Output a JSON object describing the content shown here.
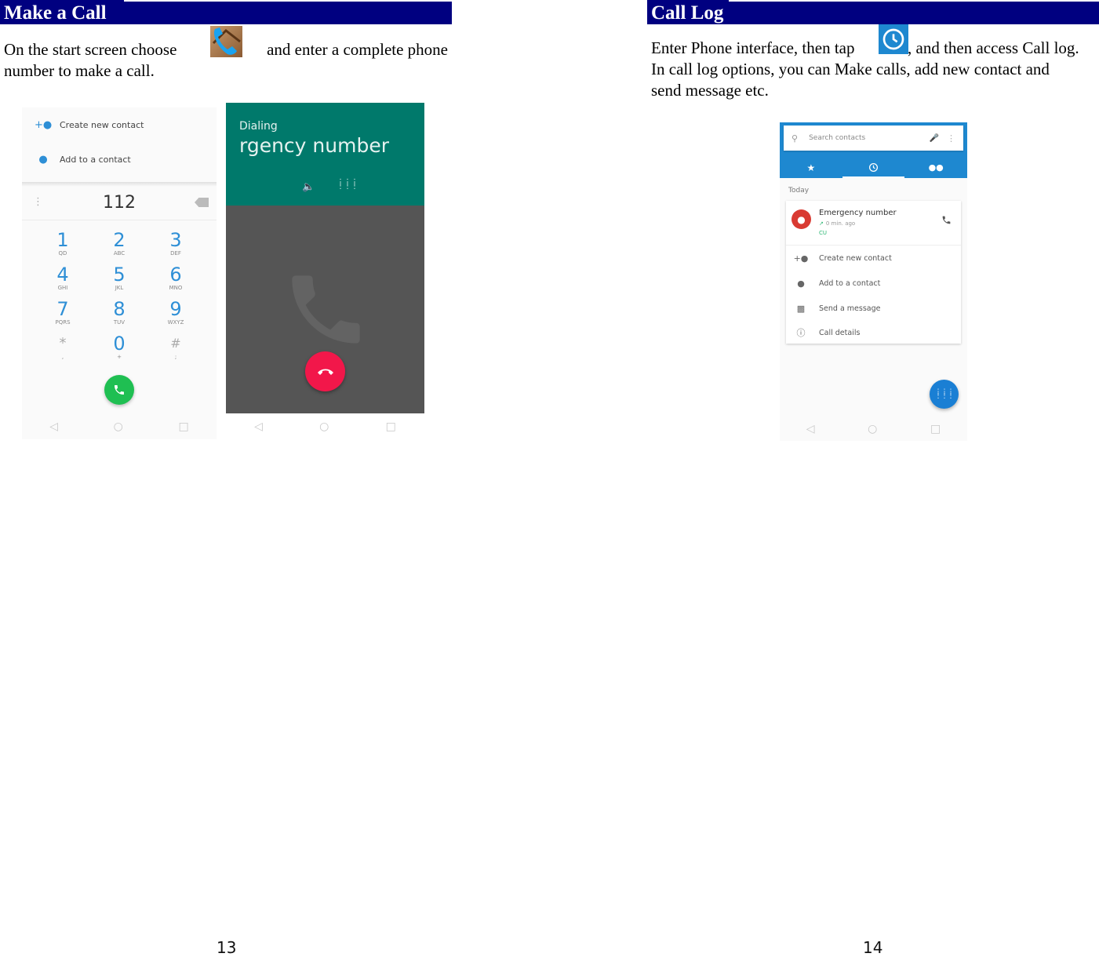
{
  "left_page": {
    "heading": "Make a Call",
    "paragraph_before_icon": "On the start screen choose",
    "inline_icon": "phone-app-icon",
    "paragraph_after_icon": "and enter a complete phone",
    "paragraph_line2": "number to make a call.",
    "page_number": "13",
    "dialer_screenshot": {
      "options": [
        {
          "icon": "add-person-icon",
          "label": "Create new contact"
        },
        {
          "icon": "person-icon",
          "label": "Add to a contact"
        }
      ],
      "entered_number": "112",
      "keys": [
        {
          "digit": "1",
          "letters": "QD"
        },
        {
          "digit": "2",
          "letters": "ABC"
        },
        {
          "digit": "3",
          "letters": "DEF"
        },
        {
          "digit": "4",
          "letters": "GHI"
        },
        {
          "digit": "5",
          "letters": "JKL"
        },
        {
          "digit": "6",
          "letters": "MNO"
        },
        {
          "digit": "7",
          "letters": "PQRS"
        },
        {
          "digit": "8",
          "letters": "TUV"
        },
        {
          "digit": "9",
          "letters": "WXYZ"
        },
        {
          "digit": "*",
          "letters": ","
        },
        {
          "digit": "0",
          "letters": "+"
        },
        {
          "digit": "#",
          "letters": ";"
        }
      ],
      "call_button_color": "#1fbf52"
    },
    "dialing_screenshot": {
      "status": "Dialing",
      "name": "rgency number",
      "header_color": "#00796b",
      "end_call_color": "#f2174a"
    }
  },
  "right_page": {
    "heading": "Call Log",
    "line1_before_icon": "Enter Phone interface, then tap",
    "inline_icon": "clock-icon",
    "line1_after_icon": ", and then access Call log.",
    "line2": "In call log options, you can Make calls, add new contact and",
    "line3": "send message etc.",
    "page_number": "14",
    "calllog_screenshot": {
      "search_placeholder": "Search contacts",
      "tabs": [
        {
          "icon": "star-icon",
          "active": false
        },
        {
          "icon": "clock-icon",
          "active": true
        },
        {
          "icon": "people-icon",
          "active": false
        }
      ],
      "section_label": "Today",
      "entry": {
        "name": "Emergency number",
        "time": "0 min. ago",
        "carrier": "CU"
      },
      "actions": [
        {
          "icon": "add-person-icon",
          "label": "Create new contact"
        },
        {
          "icon": "person-icon",
          "label": "Add to a contact"
        },
        {
          "icon": "message-icon",
          "label": "Send a message"
        },
        {
          "icon": "info-icon",
          "label": "Call details"
        }
      ],
      "accent_color": "#1e88d0"
    }
  },
  "heading_color": "#000080"
}
